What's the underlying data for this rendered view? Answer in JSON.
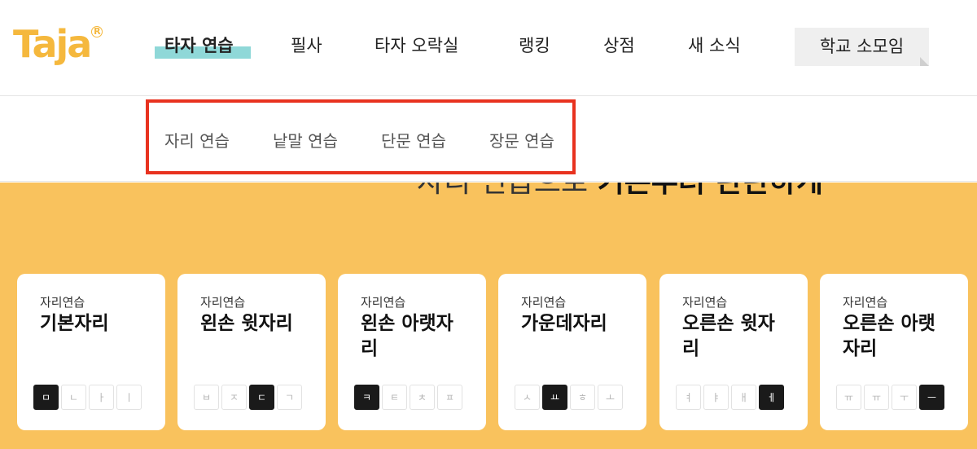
{
  "brand": {
    "logo_text": "Taja",
    "logo_mark": "R"
  },
  "nav": {
    "items": [
      {
        "label": "타자 연습",
        "active": true
      },
      {
        "label": "필사"
      },
      {
        "label": "타자 오락실"
      },
      {
        "label": "랭킹"
      },
      {
        "label": "상점"
      },
      {
        "label": "새 소식"
      }
    ],
    "school_button": "학교 소모임"
  },
  "submenu": {
    "items": [
      "자리 연습",
      "낱말 연습",
      "단문 연습",
      "장문 연습"
    ]
  },
  "hero": {
    "title_light": "자리 연습으로 ",
    "title_bold": "기본부터 탄탄하게"
  },
  "cards": [
    {
      "category": "자리연습",
      "title": "기본자리",
      "keys": [
        "ㅁ",
        "ㄴ",
        "ㅏ",
        "ㅣ"
      ],
      "active_key": 0
    },
    {
      "category": "자리연습",
      "title": "왼손 윗자리",
      "keys": [
        "ㅂ",
        "ㅈ",
        "ㄷ",
        "ㄱ"
      ],
      "active_key": 2
    },
    {
      "category": "자리연습",
      "title": "왼손 아랫자리",
      "keys": [
        "ㅋ",
        "ㅌ",
        "ㅊ",
        "ㅍ"
      ],
      "active_key": 0
    },
    {
      "category": "자리연습",
      "title": "가운데자리",
      "keys": [
        "ㅅ",
        "ㅛ",
        "ㅎ",
        "ㅗ"
      ],
      "active_key": 1
    },
    {
      "category": "자리연습",
      "title": "오른손 윗자리",
      "keys": [
        "ㅕ",
        "ㅑ",
        "ㅐ",
        "ㅔ"
      ],
      "active_key": 3
    },
    {
      "category": "자리연습",
      "title": "오른손 아랫자리",
      "keys": [
        "ㅠ",
        "ㅠ",
        "ㅜ",
        "ㅡ"
      ],
      "active_key": 3
    }
  ],
  "colors": {
    "brand": "#f5b83d",
    "highlight": "#8fd8d8",
    "hero_bg": "#f9c25d",
    "frame": "#e8321f"
  }
}
